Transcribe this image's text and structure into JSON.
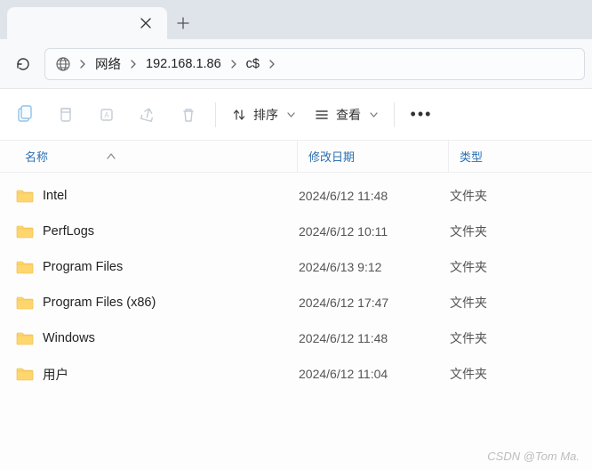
{
  "breadcrumbs": [
    "网络",
    "192.168.1.86",
    "c$"
  ],
  "toolbar": {
    "sort_label": "排序",
    "view_label": "查看"
  },
  "columns": {
    "name": "名称",
    "date": "修改日期",
    "type": "类型"
  },
  "rows": [
    {
      "name": "Intel",
      "date": "2024/6/12 11:48",
      "type": "文件夹"
    },
    {
      "name": "PerfLogs",
      "date": "2024/6/12 10:11",
      "type": "文件夹"
    },
    {
      "name": "Program Files",
      "date": "2024/6/13 9:12",
      "type": "文件夹"
    },
    {
      "name": "Program Files (x86)",
      "date": "2024/6/12 17:47",
      "type": "文件夹"
    },
    {
      "name": "Windows",
      "date": "2024/6/12 11:48",
      "type": "文件夹"
    },
    {
      "name": "用户",
      "date": "2024/6/12 11:04",
      "type": "文件夹"
    }
  ],
  "watermark": "CSDN @Tom Ma."
}
